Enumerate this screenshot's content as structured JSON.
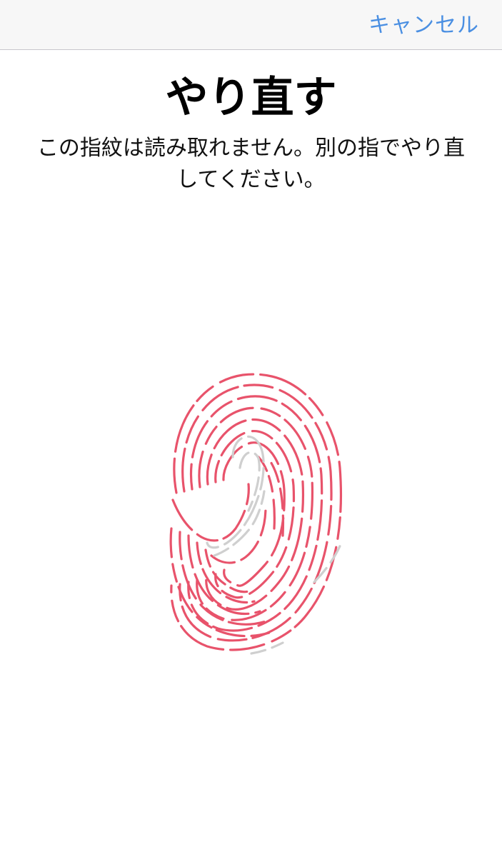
{
  "navbar": {
    "cancel_label": "キャンセル"
  },
  "main": {
    "title": "やり直す",
    "message": "この指紋は読み取れません。別の指でやり直してください。"
  },
  "fingerprint": {
    "icon": "fingerprint-icon",
    "scanned_color": "#e8536b",
    "unscanned_color": "#cfcfcf"
  },
  "colors": {
    "accent": "#4a8fe2",
    "navbar_background": "#f7f7f7"
  }
}
